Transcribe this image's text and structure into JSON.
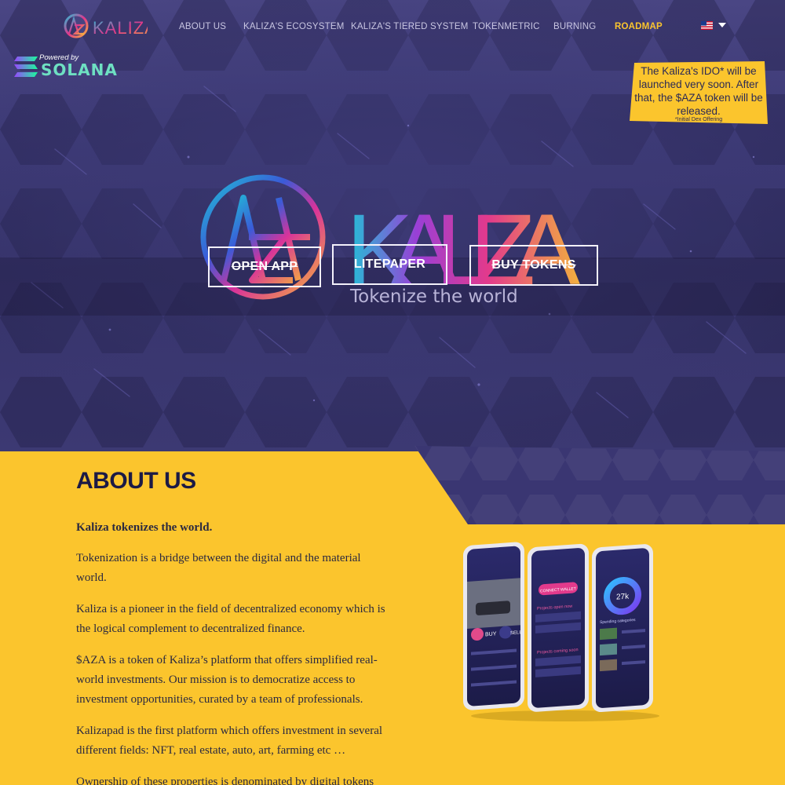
{
  "nav": {
    "logo_text": "KALIZA",
    "links": [
      {
        "label": "ABOUT US",
        "active": false
      },
      {
        "label": "KALIZA'S ECOSYSTEM",
        "active": false
      },
      {
        "label": "KALIZA'S TIERED SYSTEM",
        "active": false
      },
      {
        "label": "TOKENMETRIC",
        "active": false
      },
      {
        "label": "BURNING",
        "active": false
      },
      {
        "label": "ROADMAP",
        "active": true
      }
    ],
    "language_icon": "us-flag-icon"
  },
  "badge": {
    "powered_by": "Powered by",
    "brand": "SOLANA"
  },
  "ido_note": {
    "text": "The Kaliza's IDO* will be launched very soon. After that, the $AZA token will be released.",
    "footnote": "*Initial Dex Offering"
  },
  "hero": {
    "brand": "KALIZA",
    "tagline": "Tokenize the world",
    "buttons": {
      "open_app": "OPEN APP",
      "litepaper": "LITEPAPER",
      "buy_tokens": "BUY TOKENS"
    }
  },
  "about": {
    "title": "ABOUT US",
    "lead": "Kaliza tokenizes the world.",
    "paragraphs": [
      "Tokenization is a bridge between the digital and the material world.",
      "Kaliza is a pioneer in the field of decentralized economy which is the logical complement to decentralized finance.",
      "$AZA is a token of Kaliza’s platform that offers simplified real-world investments. Our mission is to democratize access to investment opportunities, curated by a team of professionals.",
      "Kalizapad is the first platform which offers investment in several different fields: NFT, real estate, auto, art, farming etc …",
      "Ownership of these properties is denominated by digital tokens"
    ]
  },
  "phones": {
    "buy": "BUY",
    "sell": "SELL",
    "connect_wallet": "CONNECT WALLET",
    "projects_open": "Projects open now",
    "projects_coming": "Projects coming soon",
    "stat": "27k",
    "spending": "Spending categories"
  },
  "colors": {
    "accent": "#fbc52d",
    "hero_bg": "#3d3a76",
    "title": "#1c1a45"
  }
}
